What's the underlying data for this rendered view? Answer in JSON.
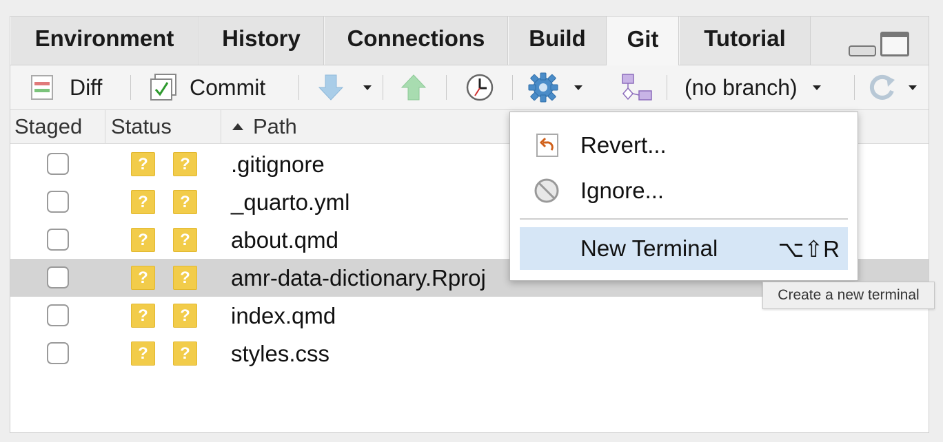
{
  "tabs": [
    {
      "label": "Environment"
    },
    {
      "label": "History"
    },
    {
      "label": "Connections"
    },
    {
      "label": "Build"
    },
    {
      "label": "Git",
      "active": true
    },
    {
      "label": "Tutorial"
    }
  ],
  "toolbar": {
    "diff_label": "Diff",
    "commit_label": "Commit",
    "branch_label": "(no branch)",
    "icons": [
      "diff-icon",
      "commit-icon",
      "pull-icon",
      "push-icon",
      "history-icon",
      "gear-icon",
      "branch-icon",
      "refresh-icon"
    ]
  },
  "columns": {
    "staged": "Staged",
    "status": "Status",
    "path": "Path"
  },
  "files": [
    {
      "path": ".gitignore",
      "status": "?"
    },
    {
      "path": "_quarto.yml",
      "status": "?"
    },
    {
      "path": "about.qmd",
      "status": "?"
    },
    {
      "path": "amr-data-dictionary.Rproj",
      "status": "?",
      "selected": true
    },
    {
      "path": "index.qmd",
      "status": "?"
    },
    {
      "path": "styles.css",
      "status": "?"
    }
  ],
  "menu": {
    "revert": "Revert...",
    "ignore": "Ignore...",
    "new_terminal": "New Terminal",
    "new_terminal_shortcut": "⌥⇧R"
  },
  "tooltip": "Create a new terminal",
  "colors": {
    "status_badge": "#f2cc4a",
    "highlight": "#d6e6f6",
    "selected_row": "#d4d4d4"
  }
}
